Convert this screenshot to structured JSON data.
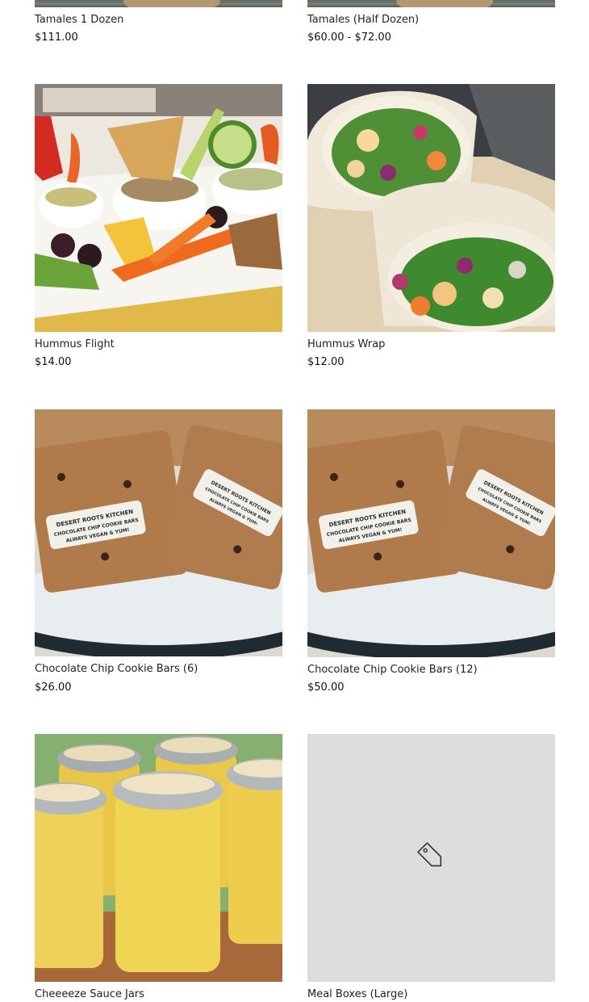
{
  "products": [
    {
      "title": "Tamales 1 Dozen",
      "price": "$111.00",
      "image": "tamales-photo"
    },
    {
      "title": "Tamales (Half Dozen)",
      "price": "$60.00 - $72.00",
      "image": "tamales-photo"
    },
    {
      "title": "Hummus Flight",
      "price": "$14.00",
      "image": "hummus-flight-photo"
    },
    {
      "title": "Hummus Wrap",
      "price": "$12.00",
      "image": "hummus-wrap-photo"
    },
    {
      "title": "Chocolate Chip Cookie Bars (6)",
      "price": "$26.00",
      "image": "cookie-bars-photo"
    },
    {
      "title": "Chocolate Chip Cookie Bars (12)",
      "price": "$50.00",
      "image": "cookie-bars-photo"
    },
    {
      "title": "Cheeeeze Sauce Jars",
      "price": "",
      "image": "sauce-jars-photo"
    },
    {
      "title": "Meal Boxes (Large)",
      "price": "",
      "image": "price-tag-icon"
    }
  ],
  "cookie_label": {
    "line1": "DESERT ROOTS KITCHEN",
    "line2": "CHOCOLATE CHIP COOKIE BARS",
    "line3": "ALWAYS VEGAN & YUM!"
  },
  "colors": {
    "placeholder_bg": "#dedcdc",
    "icon_stroke": "#333333",
    "text": "#222222"
  }
}
